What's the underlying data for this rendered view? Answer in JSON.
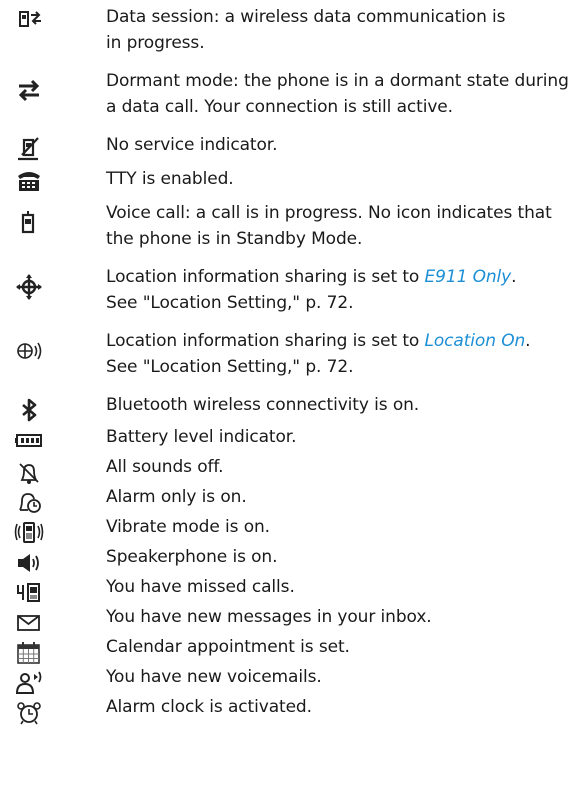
{
  "entries": [
    {
      "icon": "data-session-icon",
      "lines": [
        "Data session: a wireless data communication is",
        "in progress."
      ]
    },
    {
      "icon": "dormant-mode-icon",
      "lines": [
        "Dormant mode: the phone is in a dormant state during",
        "a data call. Your connection is still active."
      ]
    },
    {
      "icon": "no-service-icon",
      "lines": [
        "No service indicator."
      ]
    },
    {
      "icon": "tty-icon",
      "lines": [
        "TTY is enabled."
      ]
    },
    {
      "icon": "voice-call-icon",
      "lines": [
        "Voice call: a call is in progress. No icon indicates that",
        "the phone is in Standby Mode."
      ]
    },
    {
      "icon": "location-e911-icon",
      "line1_prefix": "Location information sharing is set to ",
      "line1_link": "E911 Only",
      "line1_suffix": ".",
      "line2": "See \"Location Setting,\" p. 72."
    },
    {
      "icon": "location-on-icon",
      "line1_prefix": "Location information sharing is set to ",
      "line1_link": "Location On",
      "line1_suffix": ".",
      "line2": "See \"Location Setting,\" p. 72."
    },
    {
      "icon": "bluetooth-icon",
      "lines": [
        "Bluetooth wireless connectivity is on."
      ]
    },
    {
      "icon": "battery-icon",
      "lines": [
        "Battery level indicator."
      ]
    },
    {
      "icon": "all-sounds-off-icon",
      "lines": [
        "All sounds off."
      ]
    },
    {
      "icon": "alarm-only-icon",
      "lines": [
        "Alarm only is on."
      ]
    },
    {
      "icon": "vibrate-icon",
      "lines": [
        "Vibrate mode is on."
      ]
    },
    {
      "icon": "speakerphone-icon",
      "lines": [
        "Speakerphone is on."
      ]
    },
    {
      "icon": "missed-calls-icon",
      "lines": [
        "You have missed calls."
      ]
    },
    {
      "icon": "new-message-icon",
      "lines": [
        "You have new messages in your inbox."
      ]
    },
    {
      "icon": "calendar-icon",
      "lines": [
        "Calendar appointment is set."
      ]
    },
    {
      "icon": "voicemail-icon",
      "lines": [
        "You have new voicemails."
      ]
    },
    {
      "icon": "alarm-clock-icon",
      "lines": [
        "Alarm clock is activated."
      ]
    }
  ],
  "colors": {
    "text": "#1a1a1a",
    "link": "#1d8fd6",
    "icon": "#222222"
  }
}
